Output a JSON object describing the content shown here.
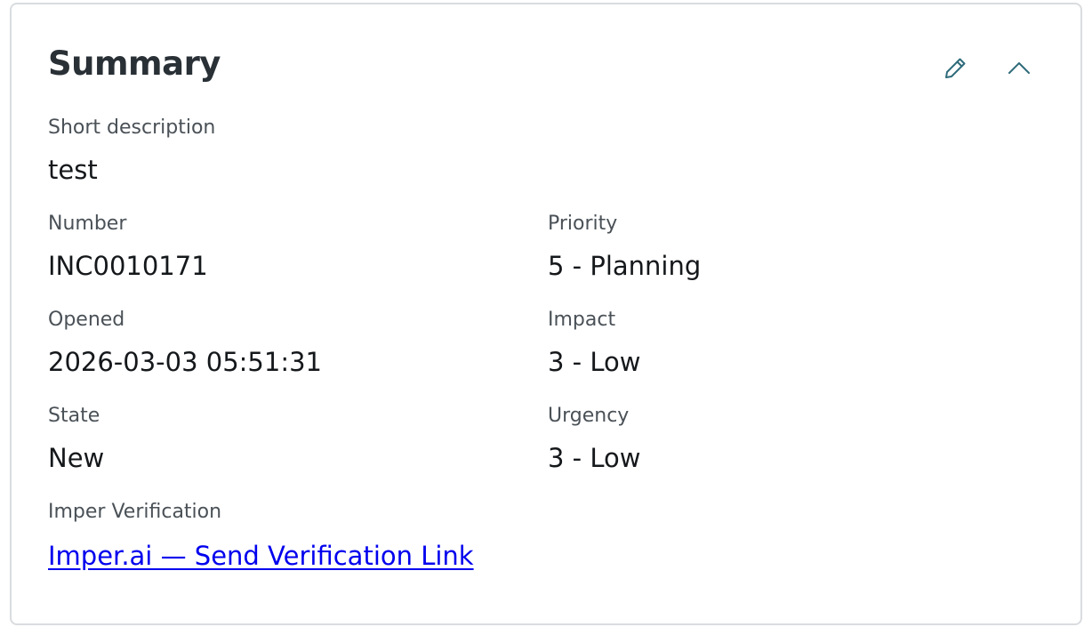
{
  "card": {
    "title": "Summary",
    "actions": [
      {
        "icon": "pencil-icon",
        "label": "edit"
      },
      {
        "icon": "chevron-up-icon",
        "label": "collapse"
      }
    ]
  },
  "fields": {
    "short_description": {
      "label": "Short description",
      "value": "test"
    },
    "number": {
      "label": "Number",
      "value": "INC0010171"
    },
    "priority": {
      "label": "Priority",
      "value": "5 - Planning"
    },
    "opened": {
      "label": "Opened",
      "value": "2026-03-03 05:51:31"
    },
    "impact": {
      "label": "Impact",
      "value": "3 - Low"
    },
    "state": {
      "label": "State",
      "value": "New"
    },
    "urgency": {
      "label": "Urgency",
      "value": "3 - Low"
    },
    "imper_verification": {
      "label": "Imper Verification",
      "link_text": "Imper.ai — Send Verification Link"
    }
  },
  "colors": {
    "icon": "#2f6b7a",
    "link": "#0000ee",
    "border": "#d9dcdf",
    "label": "#4a5157",
    "value": "#15181b"
  }
}
